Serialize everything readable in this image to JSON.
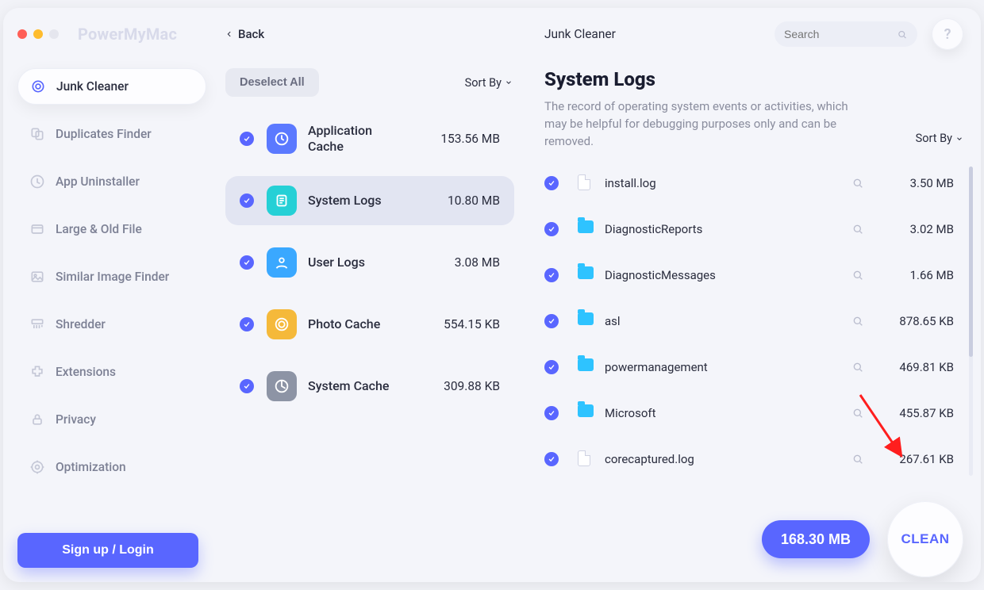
{
  "brand": "PowerMyMac",
  "back_label": "Back",
  "sidebar": {
    "items": [
      {
        "label": "Junk Cleaner"
      },
      {
        "label": "Duplicates Finder"
      },
      {
        "label": "App Uninstaller"
      },
      {
        "label": "Large & Old File"
      },
      {
        "label": "Similar Image Finder"
      },
      {
        "label": "Shredder"
      },
      {
        "label": "Extensions"
      },
      {
        "label": "Privacy"
      },
      {
        "label": "Optimization"
      }
    ],
    "login_label": "Sign up / Login"
  },
  "middle": {
    "deselect_label": "Deselect All",
    "sortby_label": "Sort By",
    "categories": [
      {
        "label": "Application Cache",
        "size": "153.56 MB",
        "color": "#5b79ff"
      },
      {
        "label": "System Logs",
        "size": "10.80 MB",
        "color": "#25d0d6",
        "selected": true
      },
      {
        "label": "User Logs",
        "size": "3.08 MB",
        "color": "#3aa8ff"
      },
      {
        "label": "Photo Cache",
        "size": "554.15 KB",
        "color": "#f5b93a"
      },
      {
        "label": "System Cache",
        "size": "309.88 KB",
        "color": "#8d94a5"
      }
    ]
  },
  "right": {
    "crumb": "Junk Cleaner",
    "search_placeholder": "Search",
    "title": "System Logs",
    "description": "The record of operating system events or activities, which may be helpful for debugging purposes only and can be removed.",
    "sortby_label": "Sort By",
    "files": [
      {
        "name": "install.log",
        "size": "3.50 MB",
        "type": "file"
      },
      {
        "name": "DiagnosticReports",
        "size": "3.02 MB",
        "type": "folder"
      },
      {
        "name": "DiagnosticMessages",
        "size": "1.66 MB",
        "type": "folder"
      },
      {
        "name": "asl",
        "size": "878.65 KB",
        "type": "folder"
      },
      {
        "name": "powermanagement",
        "size": "469.81 KB",
        "type": "folder"
      },
      {
        "name": "Microsoft",
        "size": "455.87 KB",
        "type": "folder"
      },
      {
        "name": "corecaptured.log",
        "size": "267.61 KB",
        "type": "file"
      }
    ],
    "total_size": "168.30 MB",
    "clean_label": "CLEAN"
  }
}
